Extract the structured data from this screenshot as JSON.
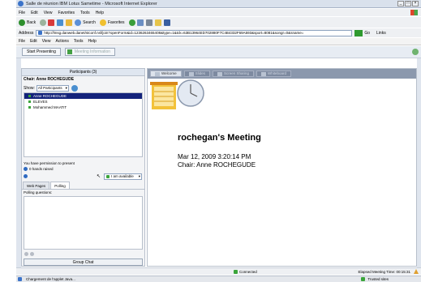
{
  "browser": {
    "title": "Salle de réunion IBM Lotus Sametime - Microsoft Internet Explorer",
    "menu": [
      "File",
      "Edit",
      "View",
      "Favorites",
      "Tools",
      "Help"
    ],
    "toolbar": {
      "back": "Back",
      "search": "Search",
      "favorites": "Favorites"
    },
    "address_label": "Address",
    "address_url": "http://lmsg.danweb.danet/stconf.nsf/join?openForm&id=1236263465408&type=1&tck=63B13964ED702880F7C4B4332F69A593&sport=8081&songr=0&sname=",
    "go_label": "Go",
    "links_label": "Links"
  },
  "app": {
    "menu": [
      "File",
      "Edit",
      "View",
      "Actions",
      "Tools",
      "Help"
    ],
    "start_presenting": "Start Presenting",
    "share_label": "Meeting Information"
  },
  "participants": {
    "header": "Participants (3)",
    "chair": "Chair: Anne ROCHEGUDE",
    "show_label": "Show:",
    "show_value": "All Participants",
    "list": [
      "Anne ROCHEGUDE",
      "ELEVES",
      "Mohammed MAATIT"
    ],
    "permission": "You have permission to present",
    "hands_raised": "0 hands raised",
    "status_value": "I am available"
  },
  "lower_tabs": [
    "Web Pages",
    "Polling"
  ],
  "polling": {
    "questions_label": "Polling questions:"
  },
  "group_chat": "Group Chat",
  "content_tabs": [
    "Welcome",
    "Slides",
    "Screen Sharing",
    "Whiteboard"
  ],
  "meeting": {
    "title": "rochegan's Meeting",
    "date": "Mar 12, 2009 3:20:14 PM",
    "chair": "Chair: Anne ROCHEGUDE"
  },
  "statusbar": {
    "connected": "Connected",
    "elapsed": "Elapsed Meeting Time: 00:15:31"
  },
  "iestatus": {
    "text": "Chargement de l'applet Java...",
    "zone": "Trusted sites"
  },
  "colors": {
    "selected_row": "#13237b",
    "status_green": "#3aa53a",
    "tab_strip": "#8b98ad"
  }
}
